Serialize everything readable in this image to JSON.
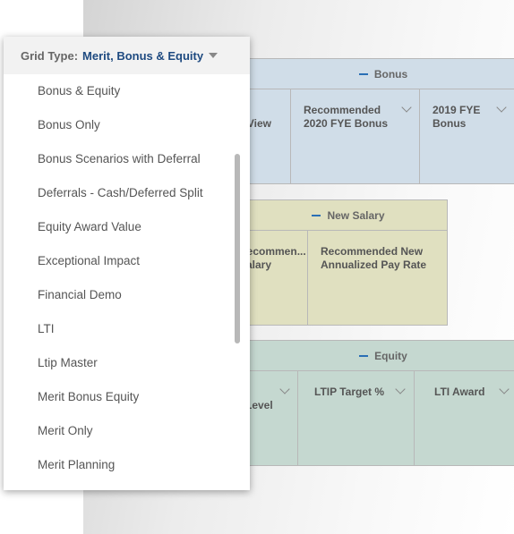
{
  "dropdown": {
    "label": "Grid Type:",
    "selected": "Merit, Bonus & Equity",
    "caret_icon": "triangle-down",
    "options": [
      "Bonus & Equity",
      "Bonus Only",
      "Bonus Scenarios with Deferral",
      "Deferrals - Cash/Deferred Split",
      "Equity Award Value",
      "Exceptional Impact",
      "Financial Demo",
      "LTI",
      "Ltip Master",
      "Merit Bonus Equity",
      "Merit Only",
      "Merit Planning"
    ]
  },
  "groups": {
    "bonus": {
      "title": "Bonus",
      "color": "#d0dde8",
      "columns": [
        "View",
        "Recommended 2020 FYE Bonus",
        "2019 FYE Bonus"
      ]
    },
    "salary": {
      "title": "New Salary",
      "color": "#e0e0c0",
      "columns": [
        "Recommen... Salary",
        "Recommended New Annualized Pay Rate"
      ]
    },
    "equity": {
      "title": "Equity",
      "color": "#c5d8d0",
      "columns": [
        "Level",
        "LTIP Target %",
        "LTI Award"
      ]
    }
  }
}
